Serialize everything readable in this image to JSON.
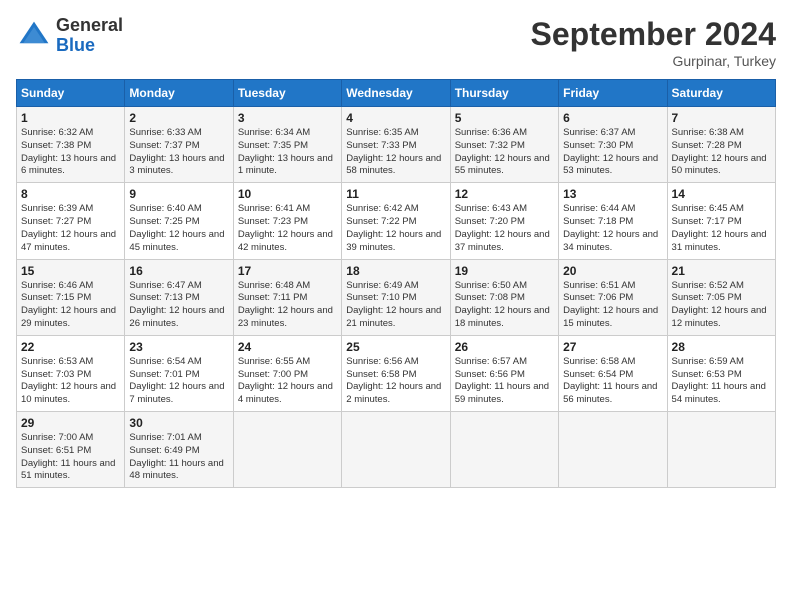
{
  "header": {
    "logo_general": "General",
    "logo_blue": "Blue",
    "month_title": "September 2024",
    "location": "Gurpinar, Turkey"
  },
  "days_of_week": [
    "Sunday",
    "Monday",
    "Tuesday",
    "Wednesday",
    "Thursday",
    "Friday",
    "Saturday"
  ],
  "weeks": [
    [
      {
        "day": "1",
        "sunrise": "Sunrise: 6:32 AM",
        "sunset": "Sunset: 7:38 PM",
        "daylight": "Daylight: 13 hours and 6 minutes."
      },
      {
        "day": "2",
        "sunrise": "Sunrise: 6:33 AM",
        "sunset": "Sunset: 7:37 PM",
        "daylight": "Daylight: 13 hours and 3 minutes."
      },
      {
        "day": "3",
        "sunrise": "Sunrise: 6:34 AM",
        "sunset": "Sunset: 7:35 PM",
        "daylight": "Daylight: 13 hours and 1 minute."
      },
      {
        "day": "4",
        "sunrise": "Sunrise: 6:35 AM",
        "sunset": "Sunset: 7:33 PM",
        "daylight": "Daylight: 12 hours and 58 minutes."
      },
      {
        "day": "5",
        "sunrise": "Sunrise: 6:36 AM",
        "sunset": "Sunset: 7:32 PM",
        "daylight": "Daylight: 12 hours and 55 minutes."
      },
      {
        "day": "6",
        "sunrise": "Sunrise: 6:37 AM",
        "sunset": "Sunset: 7:30 PM",
        "daylight": "Daylight: 12 hours and 53 minutes."
      },
      {
        "day": "7",
        "sunrise": "Sunrise: 6:38 AM",
        "sunset": "Sunset: 7:28 PM",
        "daylight": "Daylight: 12 hours and 50 minutes."
      }
    ],
    [
      {
        "day": "8",
        "sunrise": "Sunrise: 6:39 AM",
        "sunset": "Sunset: 7:27 PM",
        "daylight": "Daylight: 12 hours and 47 minutes."
      },
      {
        "day": "9",
        "sunrise": "Sunrise: 6:40 AM",
        "sunset": "Sunset: 7:25 PM",
        "daylight": "Daylight: 12 hours and 45 minutes."
      },
      {
        "day": "10",
        "sunrise": "Sunrise: 6:41 AM",
        "sunset": "Sunset: 7:23 PM",
        "daylight": "Daylight: 12 hours and 42 minutes."
      },
      {
        "day": "11",
        "sunrise": "Sunrise: 6:42 AM",
        "sunset": "Sunset: 7:22 PM",
        "daylight": "Daylight: 12 hours and 39 minutes."
      },
      {
        "day": "12",
        "sunrise": "Sunrise: 6:43 AM",
        "sunset": "Sunset: 7:20 PM",
        "daylight": "Daylight: 12 hours and 37 minutes."
      },
      {
        "day": "13",
        "sunrise": "Sunrise: 6:44 AM",
        "sunset": "Sunset: 7:18 PM",
        "daylight": "Daylight: 12 hours and 34 minutes."
      },
      {
        "day": "14",
        "sunrise": "Sunrise: 6:45 AM",
        "sunset": "Sunset: 7:17 PM",
        "daylight": "Daylight: 12 hours and 31 minutes."
      }
    ],
    [
      {
        "day": "15",
        "sunrise": "Sunrise: 6:46 AM",
        "sunset": "Sunset: 7:15 PM",
        "daylight": "Daylight: 12 hours and 29 minutes."
      },
      {
        "day": "16",
        "sunrise": "Sunrise: 6:47 AM",
        "sunset": "Sunset: 7:13 PM",
        "daylight": "Daylight: 12 hours and 26 minutes."
      },
      {
        "day": "17",
        "sunrise": "Sunrise: 6:48 AM",
        "sunset": "Sunset: 7:11 PM",
        "daylight": "Daylight: 12 hours and 23 minutes."
      },
      {
        "day": "18",
        "sunrise": "Sunrise: 6:49 AM",
        "sunset": "Sunset: 7:10 PM",
        "daylight": "Daylight: 12 hours and 21 minutes."
      },
      {
        "day": "19",
        "sunrise": "Sunrise: 6:50 AM",
        "sunset": "Sunset: 7:08 PM",
        "daylight": "Daylight: 12 hours and 18 minutes."
      },
      {
        "day": "20",
        "sunrise": "Sunrise: 6:51 AM",
        "sunset": "Sunset: 7:06 PM",
        "daylight": "Daylight: 12 hours and 15 minutes."
      },
      {
        "day": "21",
        "sunrise": "Sunrise: 6:52 AM",
        "sunset": "Sunset: 7:05 PM",
        "daylight": "Daylight: 12 hours and 12 minutes."
      }
    ],
    [
      {
        "day": "22",
        "sunrise": "Sunrise: 6:53 AM",
        "sunset": "Sunset: 7:03 PM",
        "daylight": "Daylight: 12 hours and 10 minutes."
      },
      {
        "day": "23",
        "sunrise": "Sunrise: 6:54 AM",
        "sunset": "Sunset: 7:01 PM",
        "daylight": "Daylight: 12 hours and 7 minutes."
      },
      {
        "day": "24",
        "sunrise": "Sunrise: 6:55 AM",
        "sunset": "Sunset: 7:00 PM",
        "daylight": "Daylight: 12 hours and 4 minutes."
      },
      {
        "day": "25",
        "sunrise": "Sunrise: 6:56 AM",
        "sunset": "Sunset: 6:58 PM",
        "daylight": "Daylight: 12 hours and 2 minutes."
      },
      {
        "day": "26",
        "sunrise": "Sunrise: 6:57 AM",
        "sunset": "Sunset: 6:56 PM",
        "daylight": "Daylight: 11 hours and 59 minutes."
      },
      {
        "day": "27",
        "sunrise": "Sunrise: 6:58 AM",
        "sunset": "Sunset: 6:54 PM",
        "daylight": "Daylight: 11 hours and 56 minutes."
      },
      {
        "day": "28",
        "sunrise": "Sunrise: 6:59 AM",
        "sunset": "Sunset: 6:53 PM",
        "daylight": "Daylight: 11 hours and 54 minutes."
      }
    ],
    [
      {
        "day": "29",
        "sunrise": "Sunrise: 7:00 AM",
        "sunset": "Sunset: 6:51 PM",
        "daylight": "Daylight: 11 hours and 51 minutes."
      },
      {
        "day": "30",
        "sunrise": "Sunrise: 7:01 AM",
        "sunset": "Sunset: 6:49 PM",
        "daylight": "Daylight: 11 hours and 48 minutes."
      },
      null,
      null,
      null,
      null,
      null
    ]
  ]
}
